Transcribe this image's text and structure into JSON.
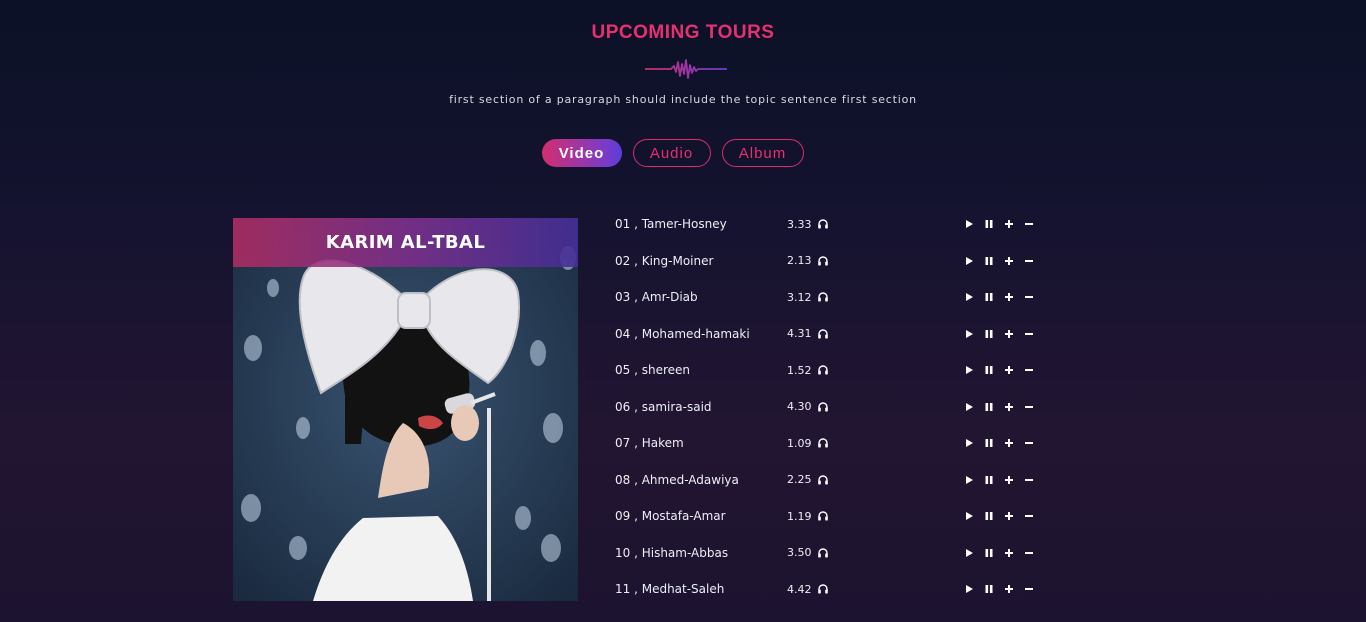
{
  "section": {
    "title": "UPCOMING TOURS",
    "subtitle": "first section of a paragraph should include the topic sentence first section"
  },
  "tabs": [
    {
      "label": "Video",
      "active": true
    },
    {
      "label": "Audio",
      "active": false
    },
    {
      "label": "Album",
      "active": false
    }
  ],
  "album": {
    "banner": "KARIM AL-TBAL"
  },
  "tracks": [
    {
      "name": "01 , Tamer-Hosney",
      "duration": "3.33"
    },
    {
      "name": "02 , King-Moiner",
      "duration": "2.13"
    },
    {
      "name": "03 , Amr-Diab",
      "duration": "3.12"
    },
    {
      "name": "04 , Mohamed-hamaki",
      "duration": "4.31"
    },
    {
      "name": "05 , shereen",
      "duration": "1.52"
    },
    {
      "name": "06 , samira-said",
      "duration": "4.30"
    },
    {
      "name": "07 , Hakem",
      "duration": "1.09"
    },
    {
      "name": "08 , Ahmed-Adawiya",
      "duration": "2.25"
    },
    {
      "name": "09 , Mostafa-Amar",
      "duration": "1.19"
    },
    {
      "name": "10 , Hisham-Abbas",
      "duration": "3.50"
    },
    {
      "name": "11 , Medhat-Saleh",
      "duration": "4.42"
    }
  ],
  "icons": {
    "track_icon": "headphones-icon",
    "controls": [
      "play-icon",
      "pause-icon",
      "plus-icon",
      "minus-icon"
    ]
  },
  "colors": {
    "accent": "#e6306f",
    "gradient_end": "#5a3ed8",
    "background": "#151330"
  }
}
